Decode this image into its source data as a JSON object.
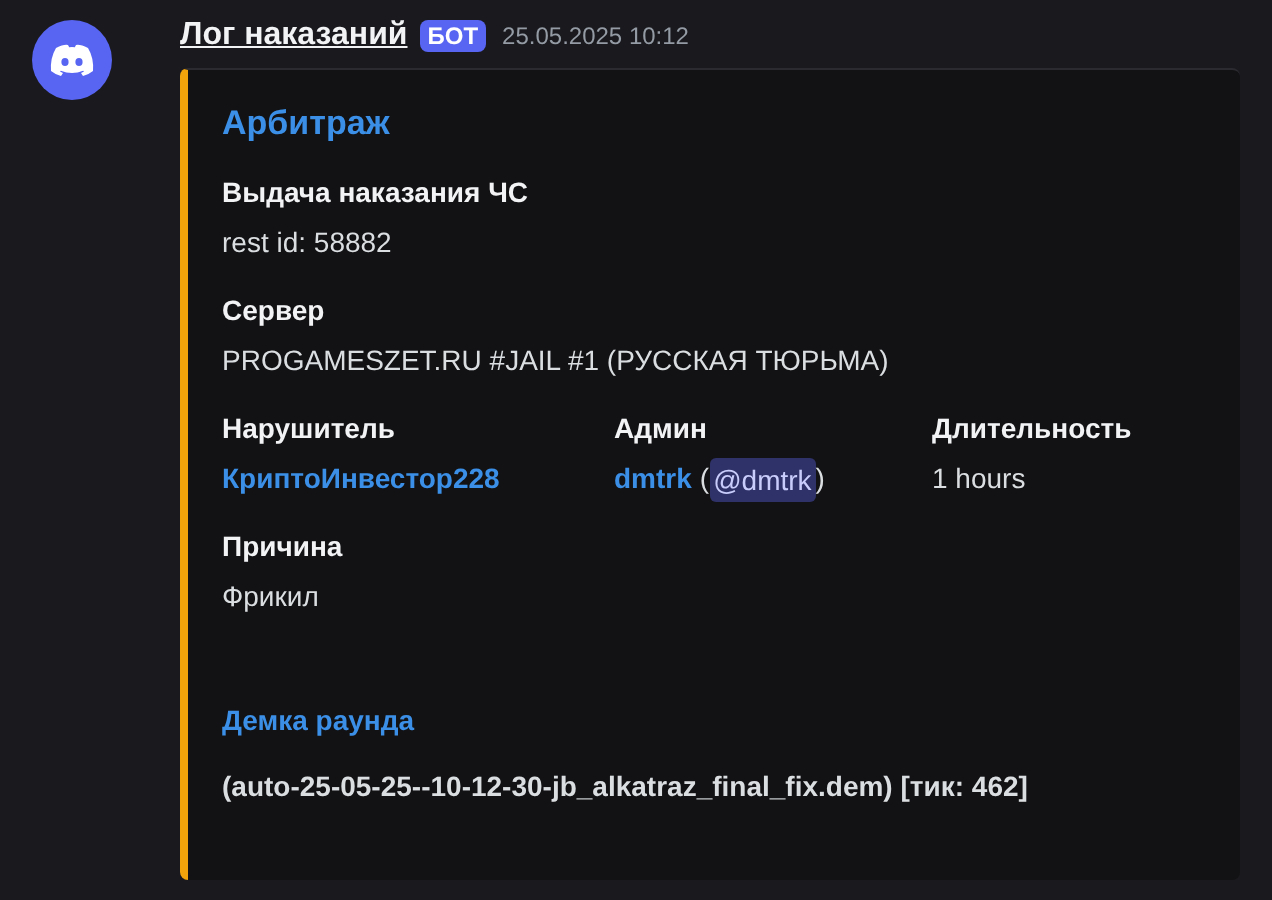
{
  "message": {
    "author": "Лог наказаний",
    "badge": "БОТ",
    "timestamp": "25.05.2025 10:12"
  },
  "embed": {
    "title": "Арбитраж",
    "fields": [
      {
        "name": "Выдача наказания ЧС",
        "inline": false,
        "value": [
          {
            "kind": "text",
            "text": "rest id: 58882"
          }
        ]
      },
      {
        "name": "Сервер",
        "inline": false,
        "value": [
          {
            "kind": "text",
            "text": "PROGAMESZET.RU #JAIL #1 (РУССКАЯ ТЮРЬМА)"
          }
        ]
      },
      {
        "name": "Нарушитель",
        "inline": true,
        "value": [
          {
            "kind": "link",
            "text": "КриптоИнвестор228"
          }
        ]
      },
      {
        "name": "Админ",
        "inline": true,
        "value": [
          {
            "kind": "link",
            "text": "dmtrk"
          },
          {
            "kind": "text",
            "text": "("
          },
          {
            "kind": "mention",
            "text": "@dmtrk"
          },
          {
            "kind": "text",
            "text": ")"
          }
        ]
      },
      {
        "name": "Длительность",
        "inline": true,
        "value": [
          {
            "kind": "text",
            "text": "1 hours"
          }
        ]
      },
      {
        "name": "Причина",
        "inline": false,
        "value": [
          {
            "kind": "text",
            "text": "Фрикил"
          }
        ]
      }
    ],
    "demo": {
      "heading": "Демка раунда",
      "text": "(auto-25-05-25--10-12-30-jb_alkatraz_final_fix.dem) [тик: 462]"
    }
  }
}
